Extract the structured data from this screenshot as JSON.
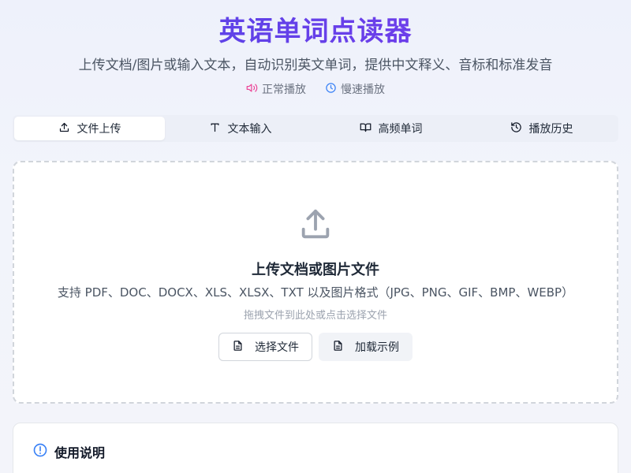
{
  "header": {
    "title": "英语单词点读器",
    "subtitle": "上传文档/图片或输入文本，自动识别英文单词，提供中文释义、音标和标准发音",
    "modes": [
      {
        "label": "正常播放",
        "icon": "volume-icon",
        "color": "#ec4899"
      },
      {
        "label": "慢速播放",
        "icon": "clock-icon",
        "color": "#3b82f6"
      }
    ]
  },
  "tabs": [
    {
      "label": "文件上传",
      "icon": "upload-icon",
      "active": true
    },
    {
      "label": "文本输入",
      "icon": "text-icon",
      "active": false
    },
    {
      "label": "高频单词",
      "icon": "book-icon",
      "active": false
    },
    {
      "label": "播放历史",
      "icon": "history-icon",
      "active": false
    }
  ],
  "dropzone": {
    "title": "上传文档或图片文件",
    "formats": "支持 PDF、DOC、DOCX、XLS、XLSX、TXT 以及图片格式（JPG、PNG、GIF、BMP、WEBP）",
    "hint": "拖拽文件到此处或点击选择文件",
    "select_button": "选择文件",
    "sample_button": "加载示例"
  },
  "usage": {
    "title": "使用说明",
    "icon": "info-icon",
    "accent": "#3b82f6"
  },
  "colors": {
    "brand": "#5b47e0",
    "brand_gradient_end": "#7c3aed"
  }
}
